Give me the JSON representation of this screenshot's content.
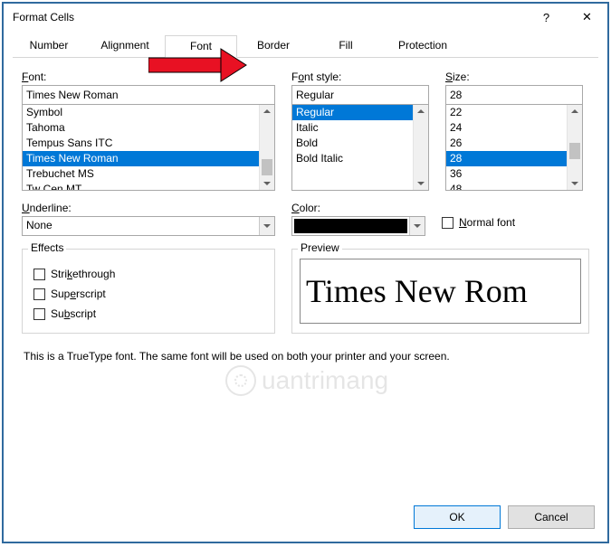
{
  "titlebar": {
    "title": "Format Cells",
    "help": "?",
    "close": "✕"
  },
  "tabs": [
    "Number",
    "Alignment",
    "Font",
    "Border",
    "Fill",
    "Protection"
  ],
  "font": {
    "label": "Font:",
    "value": "Times New Roman",
    "items": [
      "Symbol",
      "Tahoma",
      "Tempus Sans ITC",
      "Times New Roman",
      "Trebuchet MS",
      "Tw Cen MT"
    ],
    "selected": "Times New Roman"
  },
  "style": {
    "label": "Font style:",
    "value": "Regular",
    "items": [
      "Regular",
      "Italic",
      "Bold",
      "Bold Italic"
    ],
    "selected": "Regular"
  },
  "size": {
    "label": "Size:",
    "value": "28",
    "items": [
      "22",
      "24",
      "26",
      "28",
      "36",
      "48"
    ],
    "selected": "28"
  },
  "underline": {
    "label": "Underline:",
    "value": "None"
  },
  "color": {
    "label": "Color:"
  },
  "normal_font": "Normal font",
  "effects": {
    "label": "Effects",
    "items": [
      "Strikethrough",
      "Superscript",
      "Subscript"
    ]
  },
  "preview": {
    "label": "Preview",
    "text": "Times New Rom"
  },
  "footnote": "This is a TrueType font.  The same font will be used on both your printer and your screen.",
  "footer": {
    "ok": "OK",
    "cancel": "Cancel"
  },
  "watermark": "uantrimang"
}
